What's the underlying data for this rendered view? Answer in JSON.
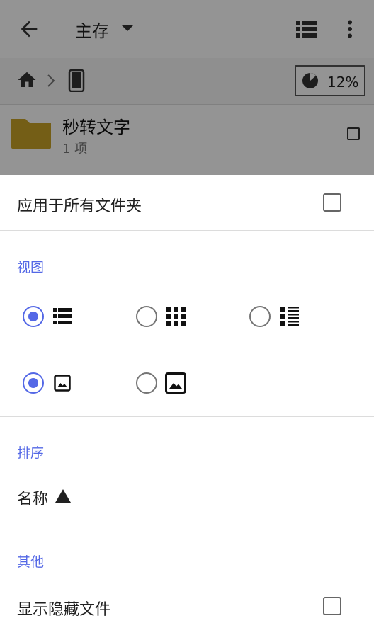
{
  "background": {
    "appbar": {
      "title": "主存",
      "icons": [
        "back-arrow-icon",
        "chevron-down-icon",
        "list-view-icon",
        "more-vert-icon"
      ]
    },
    "pathbar": {
      "icons": [
        "home-icon",
        "chevron-right-icon",
        "phone-icon",
        "storage-pie-icon"
      ],
      "storage_percent": "12%"
    },
    "files": [
      {
        "name": "秒转文字",
        "count": "1 项"
      }
    ]
  },
  "sheet": {
    "apply_all": {
      "label": "应用于所有文件夹",
      "checked": false
    },
    "view": {
      "title": "视图",
      "layout_options": [
        {
          "icon": "list-icon",
          "selected": true
        },
        {
          "icon": "grid-icon",
          "selected": false
        },
        {
          "icon": "compact-list-icon",
          "selected": false
        }
      ],
      "thumbnail_options": [
        {
          "icon": "small-image-icon",
          "selected": true
        },
        {
          "icon": "large-image-icon",
          "selected": false
        }
      ]
    },
    "sort": {
      "title": "排序",
      "value": "名称",
      "direction": "ascending"
    },
    "other": {
      "title": "其他",
      "show_hidden": {
        "label": "显示隐藏文件",
        "checked": false
      }
    }
  },
  "colors": {
    "accent": "#5468e6",
    "scrim": "#000000",
    "folder": "#c9a227"
  }
}
